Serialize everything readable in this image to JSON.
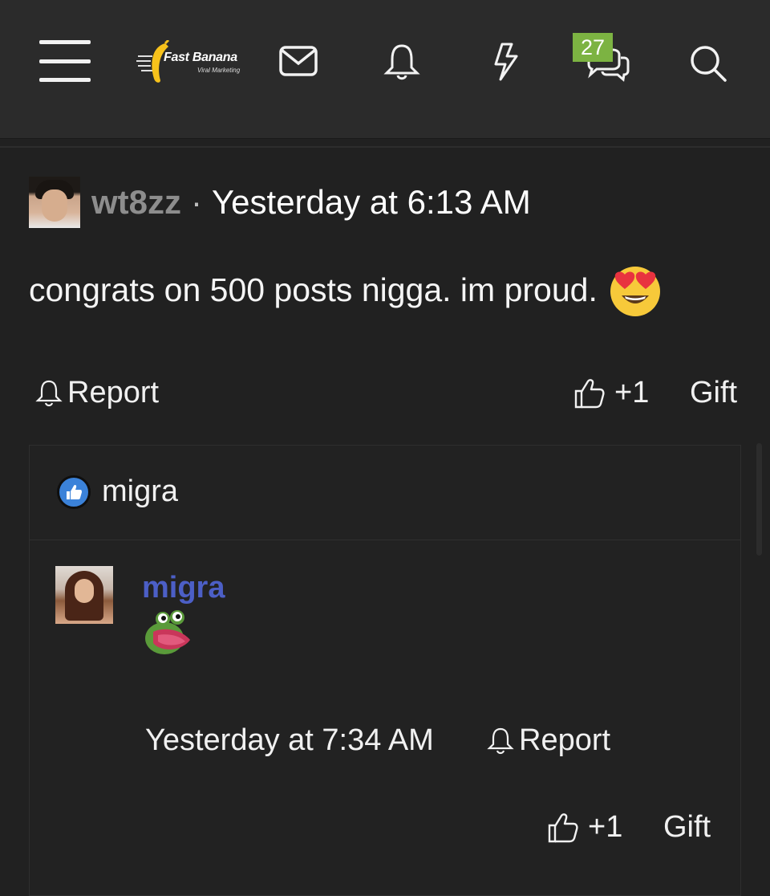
{
  "header": {
    "logo": {
      "name": "Fast Banana",
      "tagline": "Viral Marketing"
    },
    "conversations_badge": "27",
    "icons": [
      "menu-icon",
      "mail-icon",
      "bell-icon",
      "lightning-icon",
      "chat-bubbles-icon",
      "search-icon"
    ]
  },
  "post": {
    "author": "wt8zz",
    "separator": "·",
    "timestamp": "Yesterday at 6:13 AM",
    "body": "congrats on 500 posts nigga. im proud.",
    "emoji": "heart-eyes-emoji",
    "report_label": "Report",
    "like_label": "+1",
    "gift_label": "Gift"
  },
  "reply_section": {
    "reaction_user": "migra",
    "reply": {
      "author": "migra",
      "sticker": "pepe-frog-sticker",
      "timestamp": "Yesterday at 7:34 AM",
      "report_label": "Report",
      "like_label": "+1",
      "gift_label": "Gift"
    }
  },
  "colors": {
    "background": "#212121",
    "topbar": "#2b2b2b",
    "badge": "#7cb342",
    "reply_username": "#4c5fc6",
    "post_username": "#8d8d8d",
    "like_reaction": "#3b82d9"
  }
}
